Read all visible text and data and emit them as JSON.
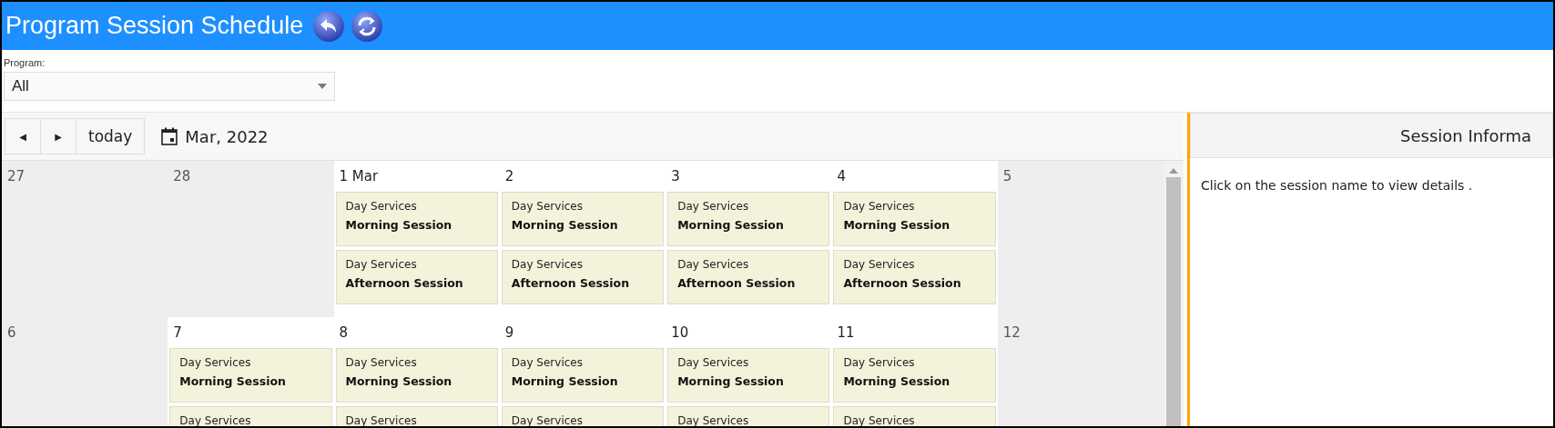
{
  "header": {
    "title": "Program Session Schedule"
  },
  "filter": {
    "label": "Program:",
    "value": "All"
  },
  "toolbar": {
    "prev": "◀",
    "next": "▶",
    "today": "today",
    "month": "Mar, 2022"
  },
  "weeks": [
    {
      "days": [
        {
          "label": "27",
          "shaded": true
        },
        {
          "label": "28",
          "shaded": true
        },
        {
          "label": "1 Mar",
          "shaded": false,
          "events": [
            {
              "program": "Day Services",
              "session": "Morning Session"
            },
            {
              "program": "Day Services",
              "session": "Afternoon Session"
            }
          ]
        },
        {
          "label": "2",
          "shaded": false,
          "events": [
            {
              "program": "Day Services",
              "session": "Morning Session"
            },
            {
              "program": "Day Services",
              "session": "Afternoon Session"
            }
          ]
        },
        {
          "label": "3",
          "shaded": false,
          "events": [
            {
              "program": "Day Services",
              "session": "Morning Session"
            },
            {
              "program": "Day Services",
              "session": "Afternoon Session"
            }
          ]
        },
        {
          "label": "4",
          "shaded": false,
          "events": [
            {
              "program": "Day Services",
              "session": "Morning Session"
            },
            {
              "program": "Day Services",
              "session": "Afternoon Session"
            }
          ]
        },
        {
          "label": "5",
          "shaded": true
        }
      ]
    },
    {
      "days": [
        {
          "label": "6",
          "shaded": true
        },
        {
          "label": "7",
          "shaded": false,
          "events": [
            {
              "program": "Day Services",
              "session": "Morning Session"
            },
            {
              "program": "Day Services"
            }
          ]
        },
        {
          "label": "8",
          "shaded": false,
          "events": [
            {
              "program": "Day Services",
              "session": "Morning Session"
            },
            {
              "program": "Day Services"
            }
          ]
        },
        {
          "label": "9",
          "shaded": false,
          "events": [
            {
              "program": "Day Services",
              "session": "Morning Session"
            },
            {
              "program": "Day Services"
            }
          ]
        },
        {
          "label": "10",
          "shaded": false,
          "events": [
            {
              "program": "Day Services",
              "session": "Morning Session"
            },
            {
              "program": "Day Services"
            }
          ]
        },
        {
          "label": "11",
          "shaded": false,
          "events": [
            {
              "program": "Day Services",
              "session": "Morning Session"
            },
            {
              "program": "Day Services"
            }
          ]
        },
        {
          "label": "12",
          "shaded": true
        }
      ]
    }
  ],
  "panel": {
    "title": "Session Informa",
    "message": "Click on the session name to view details ."
  }
}
